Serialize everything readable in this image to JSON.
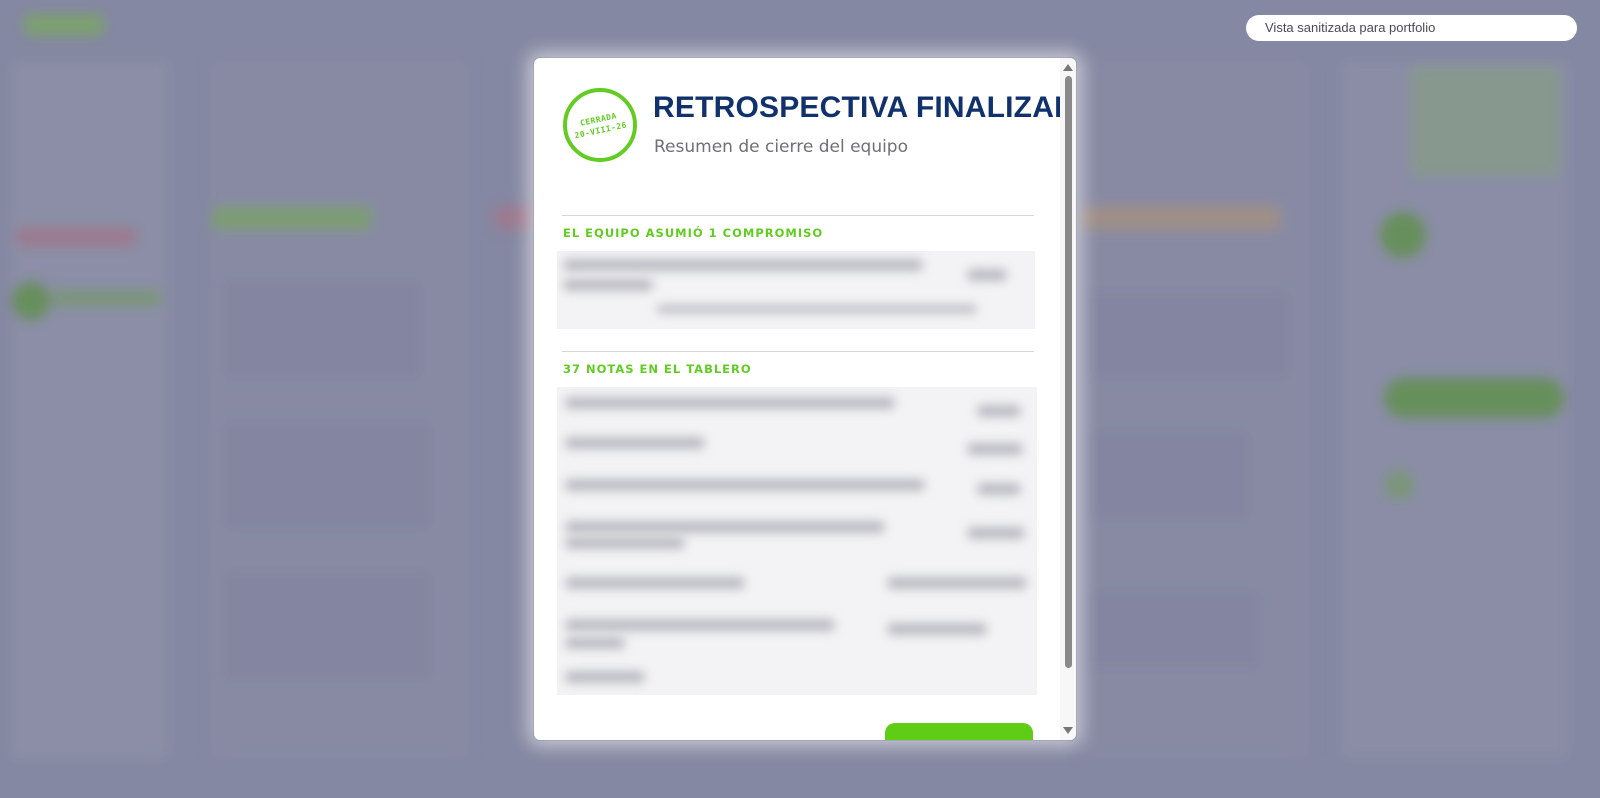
{
  "banner": {
    "text": "Vista sanitizada para portfolio"
  },
  "modal": {
    "stamp": {
      "line1": "CERRADA",
      "line2": "20-VIII-26"
    },
    "title": "RETROSPECTIVA FINALIZADA",
    "subtitle": "Resumen de cierre del equipo",
    "sections": [
      {
        "heading": "EL EQUIPO ASUMIÓ 1 COMPROMISO"
      },
      {
        "heading": "37 NOTAS EN EL TABLERO"
      }
    ]
  },
  "colors": {
    "accent_green": "#62cc22",
    "title_navy": "#10316b",
    "backdrop": "#8c8fa8"
  }
}
